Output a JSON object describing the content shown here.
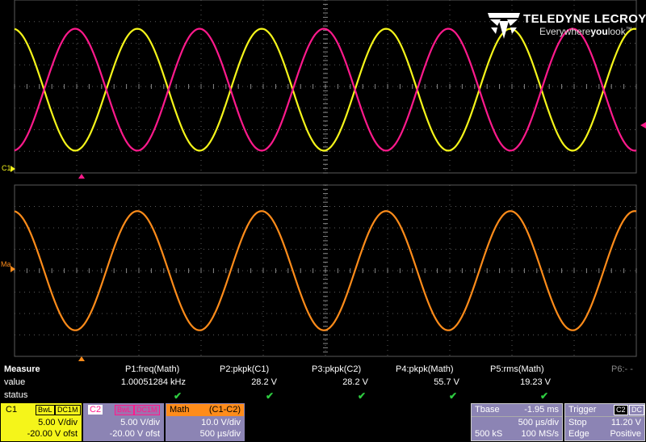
{
  "logo": {
    "brand": "TELEDYNE LECROY",
    "tagline_a": "Everywhere",
    "tagline_b": "you",
    "tagline_c": "look",
    "tm": "™"
  },
  "colors": {
    "c1": "#f5f51a",
    "c2": "#ff1a8c",
    "math": "#ff8c1a",
    "grid": "#5a5a5a"
  },
  "markers": {
    "c1": "C1",
    "math": "Ma"
  },
  "measure": {
    "title": "Measure",
    "row_value": "value",
    "row_status": "status",
    "params": [
      {
        "name": "P1:freq(Math)",
        "value": "1.00051284 kHz",
        "ok": "✔"
      },
      {
        "name": "P2:pkpk(C1)",
        "value": "28.2 V",
        "ok": "✔"
      },
      {
        "name": "P3:pkpk(C2)",
        "value": "28.2 V",
        "ok": "✔"
      },
      {
        "name": "P4:pkpk(Math)",
        "value": "55.7 V",
        "ok": "✔"
      },
      {
        "name": "P5:rms(Math)",
        "value": "19.23 V",
        "ok": "✔"
      },
      {
        "name": "P6:- -",
        "value": "",
        "ok": ""
      }
    ]
  },
  "c1_box": {
    "name": "C1",
    "bwl": "BwL",
    "dc": "DC1M",
    "scale": "5.00 V/div",
    "offset": "-20.00 V ofst"
  },
  "c2_box": {
    "name": "C2",
    "bwl": "BwL",
    "dc": "DC1M",
    "scale": "5.00 V/div",
    "offset": "-20.00 V ofst"
  },
  "math_box": {
    "name": "Math",
    "expr": "(C1-C2)",
    "scale": "10.0 V/div",
    "time": "500 µs/div"
  },
  "tbase_box": {
    "name": "Tbase",
    "delay": "-1.95 ms",
    "time": "500 µs/div",
    "samples": "500 kS",
    "rate": "100 MS/s"
  },
  "trigger_box": {
    "name": "Trigger",
    "src": "C2",
    "coup": "DC",
    "mode": "Stop",
    "level": "11.20 V",
    "type": "Edge",
    "slope": "Positive"
  },
  "waveforms": {
    "c1": {
      "freq_khz": 1.0,
      "amplitude_v": 14.1,
      "volts_per_div": 5
    },
    "c2": {
      "freq_khz": 1.0,
      "amplitude_v": 14.1,
      "volts_per_div": 5,
      "phase_deg": 180
    },
    "math": {
      "freq_khz": 1.0,
      "amplitude_v": 27.85,
      "volts_per_div": 10
    }
  }
}
